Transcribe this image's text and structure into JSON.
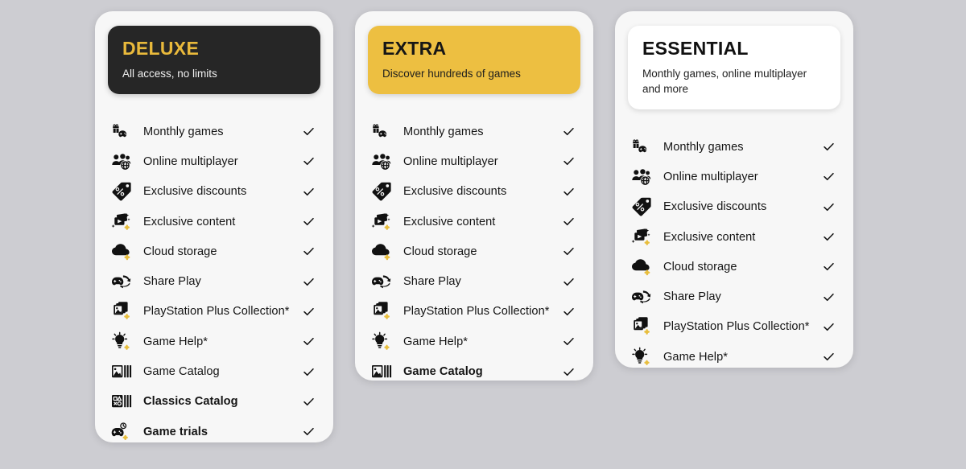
{
  "page": {
    "background_color": "#cdcdd2",
    "card_background": "#f7f7f7",
    "accent_yellow": "#edbf41",
    "deluxe_gold": "#e9b93b",
    "dark": "#262626"
  },
  "plans": [
    {
      "id": "deluxe",
      "title": "DELUXE",
      "subtitle": "All access, no limits",
      "header_style": "dark",
      "features": [
        {
          "icon": "monthly-games-icon",
          "label": "Monthly games",
          "included": true,
          "check": "✓",
          "emphasis": false
        },
        {
          "icon": "online-multiplayer-icon",
          "label": "Online multiplayer",
          "included": true,
          "check": "✓",
          "emphasis": false
        },
        {
          "icon": "exclusive-discounts-icon",
          "label": "Exclusive discounts",
          "included": true,
          "check": "✓",
          "emphasis": false
        },
        {
          "icon": "exclusive-content-icon",
          "label": "Exclusive content",
          "included": true,
          "check": "✓",
          "emphasis": false
        },
        {
          "icon": "cloud-storage-icon",
          "label": "Cloud storage",
          "included": true,
          "check": "✓",
          "emphasis": false
        },
        {
          "icon": "share-play-icon",
          "label": "Share Play",
          "included": true,
          "check": "✓",
          "emphasis": false
        },
        {
          "icon": "ps-plus-collection-icon",
          "label": "PlayStation Plus Collection*",
          "included": true,
          "check": "✓",
          "emphasis": false
        },
        {
          "icon": "game-help-icon",
          "label": "Game Help*",
          "included": true,
          "check": "✓",
          "emphasis": false
        },
        {
          "icon": "game-catalog-icon",
          "label": "Game Catalog",
          "included": true,
          "check": "✓",
          "emphasis": false
        },
        {
          "icon": "classics-catalog-icon",
          "label": "Classics Catalog",
          "included": true,
          "check": "✓",
          "emphasis": true
        },
        {
          "icon": "game-trials-icon",
          "label": "Game trials",
          "included": true,
          "check": "✓",
          "emphasis": true
        }
      ]
    },
    {
      "id": "extra",
      "title": "EXTRA",
      "subtitle": "Discover hundreds of games",
      "header_style": "yellow",
      "features": [
        {
          "icon": "monthly-games-icon",
          "label": "Monthly games",
          "included": true,
          "check": "✓",
          "emphasis": false
        },
        {
          "icon": "online-multiplayer-icon",
          "label": "Online multiplayer",
          "included": true,
          "check": "✓",
          "emphasis": false
        },
        {
          "icon": "exclusive-discounts-icon",
          "label": "Exclusive discounts",
          "included": true,
          "check": "✓",
          "emphasis": false
        },
        {
          "icon": "exclusive-content-icon",
          "label": "Exclusive content",
          "included": true,
          "check": "✓",
          "emphasis": false
        },
        {
          "icon": "cloud-storage-icon",
          "label": "Cloud storage",
          "included": true,
          "check": "✓",
          "emphasis": false
        },
        {
          "icon": "share-play-icon",
          "label": "Share Play",
          "included": true,
          "check": "✓",
          "emphasis": false
        },
        {
          "icon": "ps-plus-collection-icon",
          "label": "PlayStation Plus Collection*",
          "included": true,
          "check": "✓",
          "emphasis": false
        },
        {
          "icon": "game-help-icon",
          "label": "Game Help*",
          "included": true,
          "check": "✓",
          "emphasis": false
        },
        {
          "icon": "game-catalog-icon",
          "label": "Game Catalog",
          "included": true,
          "check": "✓",
          "emphasis": true
        }
      ]
    },
    {
      "id": "essential",
      "title": "ESSENTIAL",
      "subtitle": "Monthly games, online multiplayer and more",
      "header_style": "white",
      "features": [
        {
          "icon": "monthly-games-icon",
          "label": "Monthly games",
          "included": true,
          "check": "✓",
          "emphasis": false
        },
        {
          "icon": "online-multiplayer-icon",
          "label": "Online multiplayer",
          "included": true,
          "check": "✓",
          "emphasis": false
        },
        {
          "icon": "exclusive-discounts-icon",
          "label": "Exclusive discounts",
          "included": true,
          "check": "✓",
          "emphasis": false
        },
        {
          "icon": "exclusive-content-icon",
          "label": "Exclusive content",
          "included": true,
          "check": "✓",
          "emphasis": false
        },
        {
          "icon": "cloud-storage-icon",
          "label": "Cloud storage",
          "included": true,
          "check": "✓",
          "emphasis": false
        },
        {
          "icon": "share-play-icon",
          "label": "Share Play",
          "included": true,
          "check": "✓",
          "emphasis": false
        },
        {
          "icon": "ps-plus-collection-icon",
          "label": "PlayStation Plus Collection*",
          "included": true,
          "check": "✓",
          "emphasis": false
        },
        {
          "icon": "game-help-icon",
          "label": "Game Help*",
          "included": true,
          "check": "✓",
          "emphasis": false
        }
      ]
    }
  ]
}
